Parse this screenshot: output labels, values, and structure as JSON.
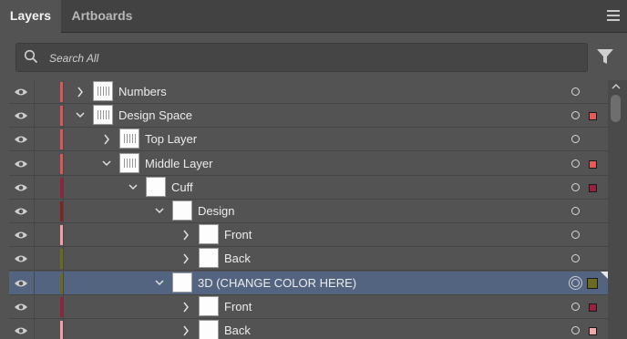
{
  "tabs": [
    {
      "label": "Layers",
      "active": true
    },
    {
      "label": "Artboards",
      "active": false
    }
  ],
  "search": {
    "placeholder": "Search All",
    "value": ""
  },
  "icons": {
    "visibility": "eye-icon",
    "expand": "chevron-right-icon",
    "collapse": "chevron-down-icon",
    "filter": "filter-funnel-icon",
    "search": "search-icon",
    "menu": "hamburger-menu-icon"
  },
  "layers": [
    {
      "name": "Numbers",
      "depth": 0,
      "expanded": false,
      "color": "#e05555",
      "selection_color": null,
      "selected": false,
      "thumb": "pattern"
    },
    {
      "name": "Design Space",
      "depth": 0,
      "expanded": true,
      "color": "#e05555",
      "selection_color": "#e85a5a",
      "selected": false,
      "thumb": "pattern"
    },
    {
      "name": "Top Layer",
      "depth": 1,
      "expanded": false,
      "color": "#e05555",
      "selection_color": null,
      "selected": false,
      "thumb": "pattern"
    },
    {
      "name": "Middle Layer",
      "depth": 1,
      "expanded": true,
      "color": "#e05555",
      "selection_color": "#e85a5a",
      "selected": false,
      "thumb": "pattern"
    },
    {
      "name": "Cuff",
      "depth": 2,
      "expanded": true,
      "color": "#9a1f3a",
      "selection_color": "#9a1f3a",
      "selected": false,
      "thumb": "blank"
    },
    {
      "name": "Design",
      "depth": 3,
      "expanded": true,
      "color": "#8a1f1f",
      "selection_color": null,
      "selected": false,
      "thumb": "blank"
    },
    {
      "name": "Front",
      "depth": 4,
      "expanded": false,
      "color": "#f0a0a8",
      "selection_color": null,
      "selected": false,
      "thumb": "blank"
    },
    {
      "name": "Back",
      "depth": 4,
      "expanded": false,
      "color": "#6b6b1e",
      "selection_color": null,
      "selected": false,
      "thumb": "blank"
    },
    {
      "name": "3D (CHANGE COLOR HERE)",
      "depth": 3,
      "expanded": true,
      "color": "#6b6b1e",
      "selection_color": "#6b6b1e",
      "selected": true,
      "thumb": "blank"
    },
    {
      "name": "Front",
      "depth": 4,
      "expanded": false,
      "color": "#9a1f3a",
      "selection_color": "#9a1f3a",
      "selected": false,
      "thumb": "blank"
    },
    {
      "name": "Back",
      "depth": 4,
      "expanded": false,
      "color": "#f0a0a8",
      "selection_color": "#f0a8a8",
      "selected": false,
      "thumb": "blank"
    }
  ]
}
